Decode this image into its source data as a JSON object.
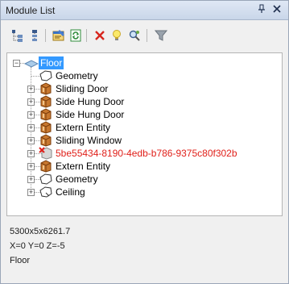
{
  "window": {
    "title": "Module List",
    "pin_glyph": "ᵖ",
    "close_glyph": "×"
  },
  "toolbar": {
    "items": [
      {
        "name": "tree-expand-icon"
      },
      {
        "name": "tree-collapse-icon"
      },
      {
        "name": "properties-icon"
      },
      {
        "name": "refresh-icon"
      },
      {
        "name": "delete-icon"
      },
      {
        "name": "lightbulb-icon"
      },
      {
        "name": "find-icon"
      },
      {
        "name": "filter-icon"
      }
    ]
  },
  "tree": {
    "root": {
      "label": "Floor",
      "icon": "floor-icon",
      "selected": true
    },
    "children": [
      {
        "label": "Geometry",
        "icon": "geometry-icon",
        "expandable": false
      },
      {
        "label": "Sliding Door",
        "icon": "module-icon",
        "expandable": true
      },
      {
        "label": "Side Hung Door",
        "icon": "module-icon",
        "expandable": true
      },
      {
        "label": "Side Hung Door",
        "icon": "module-icon",
        "expandable": true
      },
      {
        "label": "Extern Entity",
        "icon": "module-icon",
        "expandable": true
      },
      {
        "label": "Sliding Window",
        "icon": "module-icon",
        "expandable": true
      },
      {
        "label": "5be55434-8190-4edb-b786-9375c80f302b",
        "icon": "missing-module-icon",
        "expandable": true,
        "error": true
      },
      {
        "label": "Extern Entity",
        "icon": "module-icon",
        "expandable": true
      },
      {
        "label": "Geometry",
        "icon": "geometry-icon",
        "expandable": true
      },
      {
        "label": "Ceiling",
        "icon": "ceiling-icon",
        "expandable": true
      }
    ]
  },
  "info": {
    "dimensions": "5300x5x6261.7",
    "position": "X=0  Y=0  Z=-5",
    "name": "Floor"
  },
  "colors": {
    "selection": "#3399ff",
    "error_text": "#e0201a",
    "module_icon": "#b5651d"
  }
}
